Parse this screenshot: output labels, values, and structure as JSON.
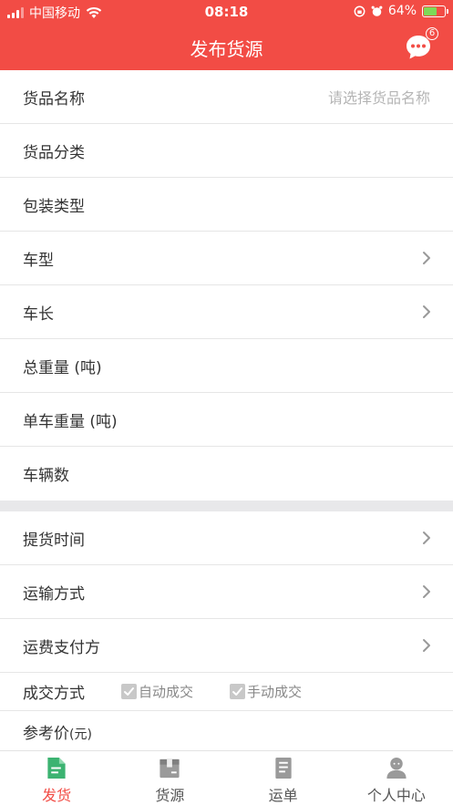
{
  "status_bar": {
    "carrier": "中国移动",
    "time": "08:18",
    "battery_percent": "64%",
    "battery_level": 0.64
  },
  "header": {
    "title": "发布货源",
    "message_badge": "6"
  },
  "form": {
    "goods_name": {
      "label": "货品名称",
      "placeholder": "请选择货品名称"
    },
    "goods_category": {
      "label": "货品分类"
    },
    "package_type": {
      "label": "包装类型"
    },
    "vehicle_type": {
      "label": "车型"
    },
    "vehicle_length": {
      "label": "车长"
    },
    "total_weight": {
      "label": "总重量 (吨)"
    },
    "single_weight": {
      "label": "单车重量 (吨)"
    },
    "vehicle_count": {
      "label": "车辆数"
    },
    "pickup_time": {
      "label": "提货时间"
    },
    "transport_mode": {
      "label": "运输方式"
    },
    "freight_payer": {
      "label": "运费支付方"
    },
    "deal_method": {
      "label": "成交方式",
      "auto": "自动成交",
      "manual": "手动成交"
    },
    "reference_price": {
      "label": "参考价",
      "unit": "(元)"
    }
  },
  "tabs": [
    {
      "label": "发货",
      "icon": "document-icon",
      "active": true
    },
    {
      "label": "货源",
      "icon": "box-icon",
      "active": false
    },
    {
      "label": "运单",
      "icon": "list-icon",
      "active": false
    },
    {
      "label": "个人中心",
      "icon": "user-icon",
      "active": false
    }
  ],
  "colors": {
    "primary": "#f24c45",
    "divider": "#e6e6e6",
    "active_tab_icon": "#3cb371"
  }
}
